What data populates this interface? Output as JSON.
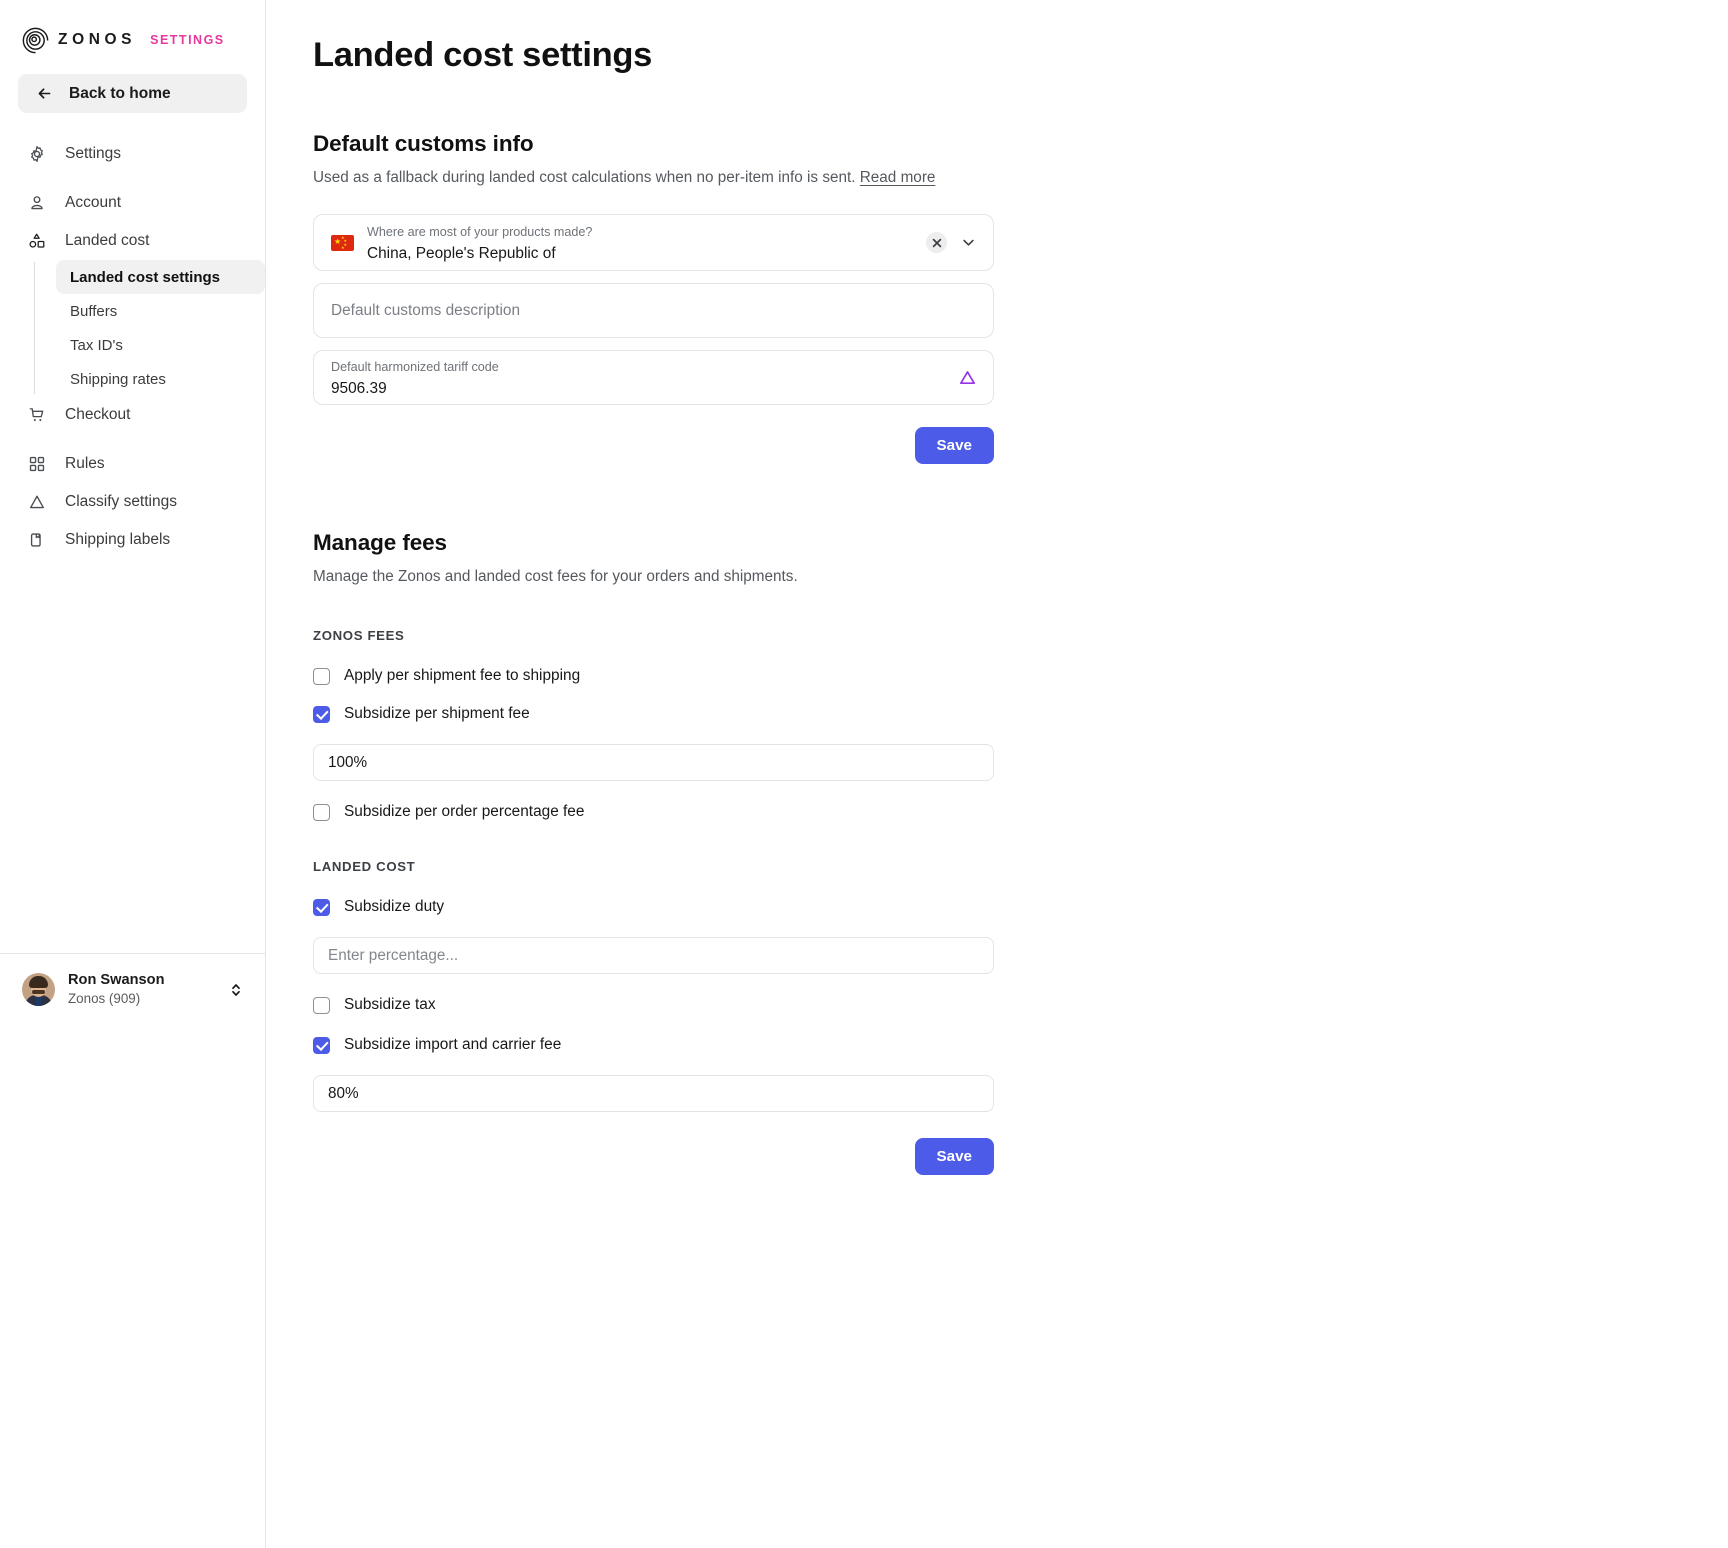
{
  "brand": {
    "word": "ZONOS",
    "sub": "SETTINGS",
    "logo_icon": "zonos-spiral-logo",
    "accent_pink": "#e5399e"
  },
  "sidebar": {
    "back": {
      "label": "Back to home",
      "icon": "arrow-left-icon"
    },
    "items": [
      {
        "label": "Settings",
        "icon": "gear-icon"
      },
      {
        "label": "Account",
        "icon": "user-icon"
      },
      {
        "label": "Landed cost",
        "icon": "shapes-icon"
      },
      {
        "label": "Checkout",
        "icon": "shopping-cart-icon"
      },
      {
        "label": "Rules",
        "icon": "grid-squares-icon"
      },
      {
        "label": "Classify settings",
        "icon": "triangle-icon"
      },
      {
        "label": "Shipping labels",
        "icon": "label-tag-icon"
      }
    ],
    "sub_items": [
      {
        "label": "Landed cost settings",
        "active": true
      },
      {
        "label": "Buffers",
        "active": false
      },
      {
        "label": "Tax ID's",
        "active": false
      },
      {
        "label": "Shipping rates",
        "active": false
      }
    ],
    "user": {
      "name": "Ron Swanson",
      "org": "Zonos (909)",
      "avatar_icon": "user-avatar",
      "switcher_icon": "chevron-up-down-icon"
    }
  },
  "page": {
    "title": "Landed cost settings"
  },
  "customs": {
    "heading": "Default customs info",
    "description": "Used as a fallback during landed cost calculations when no per-item info is sent.",
    "read_more": "Read more",
    "country": {
      "label": "Where are most of your products made?",
      "value": "China, People's Republic of",
      "flag_icon": "flag-china-icon",
      "clear_icon": "clear-x-icon",
      "chevron_icon": "chevron-down-icon"
    },
    "customs_description": {
      "label": "Default customs description",
      "value": "",
      "placeholder": "Default customs description"
    },
    "tariff_code": {
      "label": "Default harmonized tariff code",
      "value": "9506.39",
      "warning_icon": "warning-triangle-icon",
      "warning_color": "#9333ea"
    },
    "save_label": "Save"
  },
  "fees": {
    "heading": "Manage fees",
    "description": "Manage the Zonos and landed cost fees for your orders and shipments.",
    "zonos_group_label": "ZONOS FEES",
    "landed_group_label": "LANDED COST",
    "zonos_checks": [
      {
        "label": "Apply per shipment fee to shipping",
        "checked": false
      },
      {
        "label": "Subsidize per shipment fee",
        "checked": true
      },
      {
        "label": "Subsidize per order percentage fee",
        "checked": false
      }
    ],
    "per_shipment_value": "100%",
    "landed_checks": [
      {
        "label": "Subsidize duty",
        "checked": true
      },
      {
        "label": "Subsidize tax",
        "checked": false
      },
      {
        "label": "Subsidize import and carrier fee",
        "checked": true
      }
    ],
    "duty_placeholder": "Enter percentage...",
    "duty_value": "",
    "import_carrier_value": "80%",
    "save_label": "Save"
  },
  "colors": {
    "primary": "#4d5ce8",
    "pink": "#e5399e",
    "warning": "#9333ea"
  }
}
